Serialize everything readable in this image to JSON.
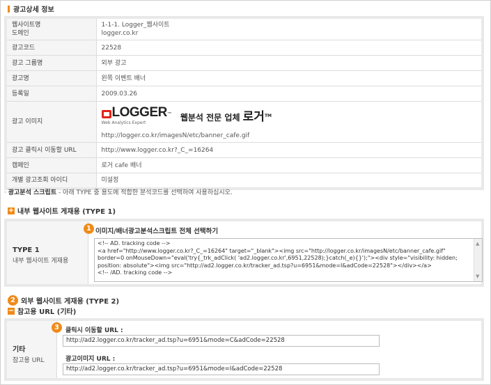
{
  "section_title": "광고상세 정보",
  "info_rows": [
    {
      "label": "웹사이트명",
      "label2": "도메인",
      "value": "1-1-1. Logger_웹사이트",
      "value2": "logger.co.kr"
    },
    {
      "label": "광고코드",
      "value": "22528"
    },
    {
      "label": "광고 그룹명",
      "value": "외부 광고"
    },
    {
      "label": "광고명",
      "value": "왼쪽 이벤트 배너"
    },
    {
      "label": "등록일",
      "value": "2009.03.26"
    }
  ],
  "image_row": {
    "label": "광고 이미지",
    "logo_word": "LOGGER",
    "logo_tm": "™",
    "logo_sub": "Web Analytics Expert",
    "tagline": "웹분석 전문 업체",
    "tagline_big": "로거",
    "tagline_tm": "TM",
    "url": "http://logger.co.kr/imagesN/etc/banner_cafe.gif"
  },
  "info_rows2": [
    {
      "label": "광고 클릭시 이동할 URL",
      "value": "http://www.logger.co.kr?_C_=16264"
    },
    {
      "label": "캠페인",
      "value": " 로거 cafe 배너"
    },
    {
      "label": "개별 광고조회 아이디",
      "value": "미설정"
    }
  ],
  "script_title": "광고분석 스크립트",
  "script_desc": " - 아래 TYPE 중 용도에 적합한 분석코드를 선택하여 사용하십시오.",
  "type1": {
    "header": "내부 웹사이트 게재용 (TYPE 1)",
    "label": "TYPE 1",
    "sublabel": "내부 웹사이트 게재용",
    "badge": "1",
    "select_link": "이미지/배너광고분석스크립트 전체 선택하기",
    "code_lines": [
      "<!-- AD. tracking code -->",
      "<a href=\"http://www.logger.co.kr?_C_=16264\" target=\"_blank\"><img src=\"http://logger.co.kr/imagesN/etc/banner_cafe.gif\"",
      "border=0 onMouseDown=\"eval('try{_trk_adClick( 'ad2.logger.co.kr',6951,22528);}catch(_e){}');\"><div style=\"visibility: hidden;",
      "position: absolute\"><img src=\"http://ad2.logger.co.kr/tracker_ad.tsp?u=6951&mode=I&adCode=22528\"></div></a>",
      "<!-- /AD. tracking code -->"
    ]
  },
  "type2": {
    "header": "외부 웹사이트 게재용 (TYPE 2)",
    "badge": "2"
  },
  "etc": {
    "header": "참고용 URL (기타)",
    "label": "기타",
    "sublabel": "참고용 URL",
    "badge": "3",
    "click_label": "클릭시 이동할 URL :",
    "click_url": "http://ad2.logger.co.kr/tracker_ad.tsp?u=6951&mode=C&adCode=22528",
    "image_label": "광고이미지 URL :",
    "image_url": "http://ad2.logger.co.kr/tracker_ad.tsp?u=6951&mode=I&adCode=22528"
  },
  "colors": {
    "accent": "#f08a18",
    "logo_red": "#e2231a"
  }
}
